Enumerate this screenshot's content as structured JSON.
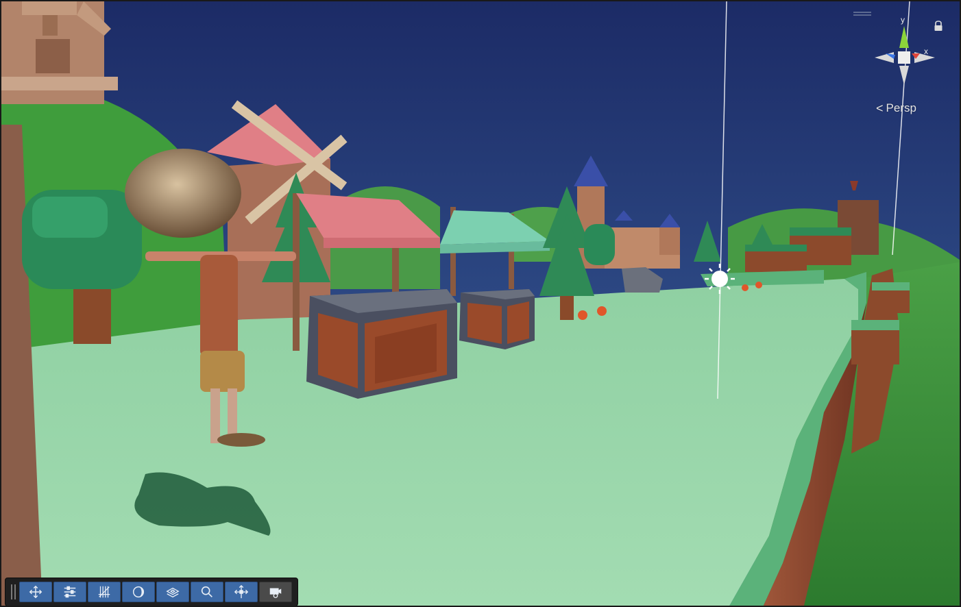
{
  "scene_view": {
    "camera_mode_label": "Persp",
    "gizmo": {
      "y_label": "y",
      "x_label": "x",
      "colors": {
        "y_axis": "#8cd43a",
        "x_axis": "#e0463b",
        "z_axis": "#3c77e8",
        "neutral": "#d9d9d9"
      }
    },
    "lock_icon": "lock-icon"
  },
  "toolbar": {
    "tools": [
      {
        "name": "move-tool",
        "icon": "move-arrows-icon",
        "active": true
      },
      {
        "name": "transform-tool",
        "icon": "sliders-icon",
        "active": true
      },
      {
        "name": "grid-snap-tool",
        "icon": "grid-snap-icon",
        "active": true
      },
      {
        "name": "lighting-toggle",
        "icon": "moon-icon",
        "active": true
      },
      {
        "name": "layers-tool",
        "icon": "layers-icon",
        "active": true
      },
      {
        "name": "search-tool",
        "icon": "magnifier-icon",
        "active": true
      },
      {
        "name": "pivot-tool",
        "icon": "pivot-icon",
        "active": true
      },
      {
        "name": "camera-tool",
        "icon": "camera-icon",
        "active": false
      }
    ]
  },
  "colors": {
    "sky_top": "#1f2f6b",
    "sky_horizon": "#5a7aa2",
    "ground": "#9bd6a8",
    "grass": "#3e9a3a",
    "tree_green": "#2f8a56",
    "brown": "#8a4a2a",
    "awning_pink": "#e07f86",
    "awning_mint": "#7cd0b0",
    "toolbar_bg": "#1f1f1f",
    "tool_active": "#3d6aa6"
  }
}
